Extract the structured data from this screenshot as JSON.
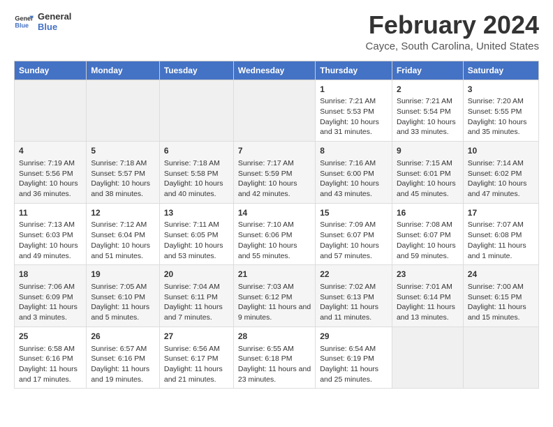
{
  "logo": {
    "line1": "General",
    "line2": "Blue"
  },
  "title": "February 2024",
  "subtitle": "Cayce, South Carolina, United States",
  "days_of_week": [
    "Sunday",
    "Monday",
    "Tuesday",
    "Wednesday",
    "Thursday",
    "Friday",
    "Saturday"
  ],
  "weeks": [
    [
      {
        "day": "",
        "empty": true
      },
      {
        "day": "",
        "empty": true
      },
      {
        "day": "",
        "empty": true
      },
      {
        "day": "",
        "empty": true
      },
      {
        "day": "1",
        "sunrise": "Sunrise: 7:21 AM",
        "sunset": "Sunset: 5:53 PM",
        "daylight": "Daylight: 10 hours and 31 minutes."
      },
      {
        "day": "2",
        "sunrise": "Sunrise: 7:21 AM",
        "sunset": "Sunset: 5:54 PM",
        "daylight": "Daylight: 10 hours and 33 minutes."
      },
      {
        "day": "3",
        "sunrise": "Sunrise: 7:20 AM",
        "sunset": "Sunset: 5:55 PM",
        "daylight": "Daylight: 10 hours and 35 minutes."
      }
    ],
    [
      {
        "day": "4",
        "sunrise": "Sunrise: 7:19 AM",
        "sunset": "Sunset: 5:56 PM",
        "daylight": "Daylight: 10 hours and 36 minutes."
      },
      {
        "day": "5",
        "sunrise": "Sunrise: 7:18 AM",
        "sunset": "Sunset: 5:57 PM",
        "daylight": "Daylight: 10 hours and 38 minutes."
      },
      {
        "day": "6",
        "sunrise": "Sunrise: 7:18 AM",
        "sunset": "Sunset: 5:58 PM",
        "daylight": "Daylight: 10 hours and 40 minutes."
      },
      {
        "day": "7",
        "sunrise": "Sunrise: 7:17 AM",
        "sunset": "Sunset: 5:59 PM",
        "daylight": "Daylight: 10 hours and 42 minutes."
      },
      {
        "day": "8",
        "sunrise": "Sunrise: 7:16 AM",
        "sunset": "Sunset: 6:00 PM",
        "daylight": "Daylight: 10 hours and 43 minutes."
      },
      {
        "day": "9",
        "sunrise": "Sunrise: 7:15 AM",
        "sunset": "Sunset: 6:01 PM",
        "daylight": "Daylight: 10 hours and 45 minutes."
      },
      {
        "day": "10",
        "sunrise": "Sunrise: 7:14 AM",
        "sunset": "Sunset: 6:02 PM",
        "daylight": "Daylight: 10 hours and 47 minutes."
      }
    ],
    [
      {
        "day": "11",
        "sunrise": "Sunrise: 7:13 AM",
        "sunset": "Sunset: 6:03 PM",
        "daylight": "Daylight: 10 hours and 49 minutes."
      },
      {
        "day": "12",
        "sunrise": "Sunrise: 7:12 AM",
        "sunset": "Sunset: 6:04 PM",
        "daylight": "Daylight: 10 hours and 51 minutes."
      },
      {
        "day": "13",
        "sunrise": "Sunrise: 7:11 AM",
        "sunset": "Sunset: 6:05 PM",
        "daylight": "Daylight: 10 hours and 53 minutes."
      },
      {
        "day": "14",
        "sunrise": "Sunrise: 7:10 AM",
        "sunset": "Sunset: 6:06 PM",
        "daylight": "Daylight: 10 hours and 55 minutes."
      },
      {
        "day": "15",
        "sunrise": "Sunrise: 7:09 AM",
        "sunset": "Sunset: 6:07 PM",
        "daylight": "Daylight: 10 hours and 57 minutes."
      },
      {
        "day": "16",
        "sunrise": "Sunrise: 7:08 AM",
        "sunset": "Sunset: 6:07 PM",
        "daylight": "Daylight: 10 hours and 59 minutes."
      },
      {
        "day": "17",
        "sunrise": "Sunrise: 7:07 AM",
        "sunset": "Sunset: 6:08 PM",
        "daylight": "Daylight: 11 hours and 1 minute."
      }
    ],
    [
      {
        "day": "18",
        "sunrise": "Sunrise: 7:06 AM",
        "sunset": "Sunset: 6:09 PM",
        "daylight": "Daylight: 11 hours and 3 minutes."
      },
      {
        "day": "19",
        "sunrise": "Sunrise: 7:05 AM",
        "sunset": "Sunset: 6:10 PM",
        "daylight": "Daylight: 11 hours and 5 minutes."
      },
      {
        "day": "20",
        "sunrise": "Sunrise: 7:04 AM",
        "sunset": "Sunset: 6:11 PM",
        "daylight": "Daylight: 11 hours and 7 minutes."
      },
      {
        "day": "21",
        "sunrise": "Sunrise: 7:03 AM",
        "sunset": "Sunset: 6:12 PM",
        "daylight": "Daylight: 11 hours and 9 minutes."
      },
      {
        "day": "22",
        "sunrise": "Sunrise: 7:02 AM",
        "sunset": "Sunset: 6:13 PM",
        "daylight": "Daylight: 11 hours and 11 minutes."
      },
      {
        "day": "23",
        "sunrise": "Sunrise: 7:01 AM",
        "sunset": "Sunset: 6:14 PM",
        "daylight": "Daylight: 11 hours and 13 minutes."
      },
      {
        "day": "24",
        "sunrise": "Sunrise: 7:00 AM",
        "sunset": "Sunset: 6:15 PM",
        "daylight": "Daylight: 11 hours and 15 minutes."
      }
    ],
    [
      {
        "day": "25",
        "sunrise": "Sunrise: 6:58 AM",
        "sunset": "Sunset: 6:16 PM",
        "daylight": "Daylight: 11 hours and 17 minutes."
      },
      {
        "day": "26",
        "sunrise": "Sunrise: 6:57 AM",
        "sunset": "Sunset: 6:16 PM",
        "daylight": "Daylight: 11 hours and 19 minutes."
      },
      {
        "day": "27",
        "sunrise": "Sunrise: 6:56 AM",
        "sunset": "Sunset: 6:17 PM",
        "daylight": "Daylight: 11 hours and 21 minutes."
      },
      {
        "day": "28",
        "sunrise": "Sunrise: 6:55 AM",
        "sunset": "Sunset: 6:18 PM",
        "daylight": "Daylight: 11 hours and 23 minutes."
      },
      {
        "day": "29",
        "sunrise": "Sunrise: 6:54 AM",
        "sunset": "Sunset: 6:19 PM",
        "daylight": "Daylight: 11 hours and 25 minutes."
      },
      {
        "day": "",
        "empty": true
      },
      {
        "day": "",
        "empty": true
      }
    ]
  ]
}
